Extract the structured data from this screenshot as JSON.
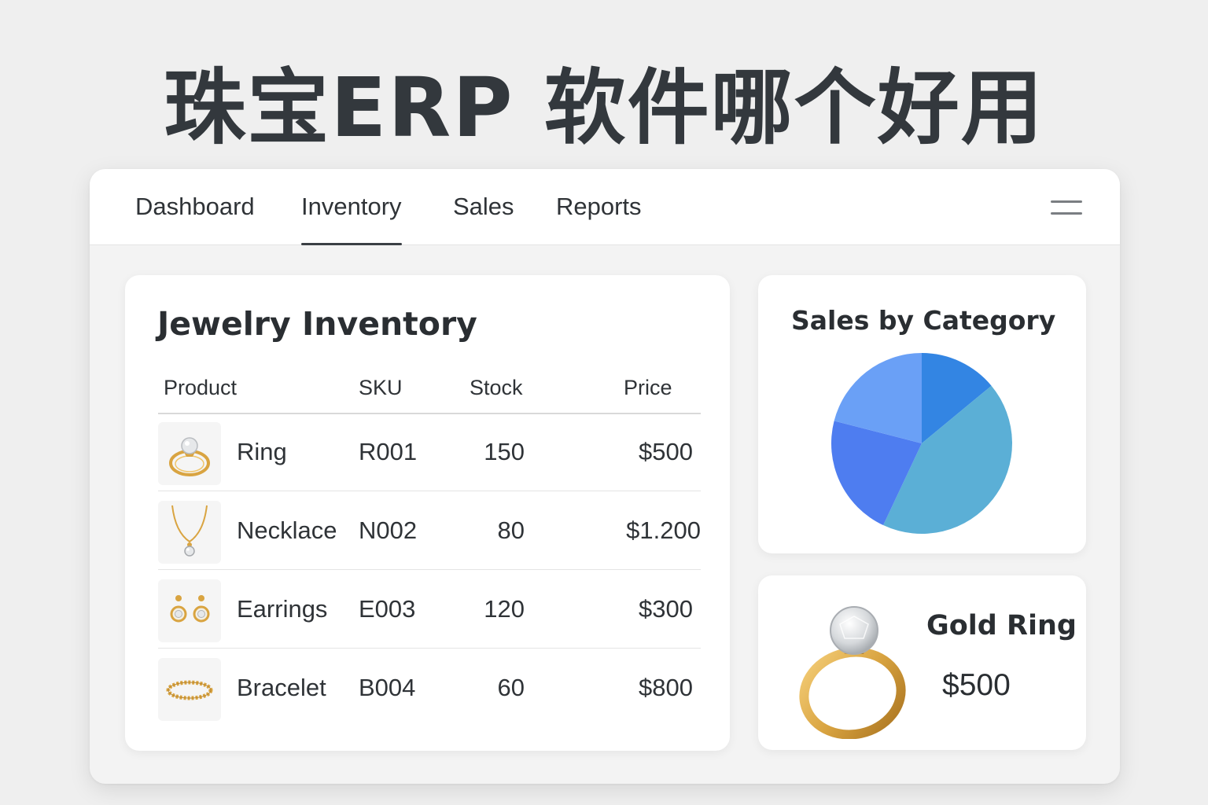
{
  "headline": "珠宝ERP 软件哪个好用",
  "nav": {
    "tabs": [
      {
        "label": "Dashboard"
      },
      {
        "label": "Inventory"
      },
      {
        "label": "Sales"
      },
      {
        "label": "Reports"
      }
    ],
    "active_tab": "Inventory"
  },
  "inventory": {
    "title": "Jewelry Inventory",
    "columns": [
      "Product",
      "SKU",
      "Stock",
      "Price"
    ],
    "rows": [
      {
        "product": "Ring",
        "sku": "R001",
        "stock": "150",
        "price": "$500",
        "icon": "ring-icon"
      },
      {
        "product": "Necklace",
        "sku": "N002",
        "stock": "80",
        "price": "$1.200",
        "icon": "necklace-icon"
      },
      {
        "product": "Earrings",
        "sku": "E003",
        "stock": "120",
        "price": "$300",
        "icon": "earrings-icon"
      },
      {
        "product": "Bracelet",
        "sku": "B004",
        "stock": "60",
        "price": "$800",
        "icon": "bracelet-icon"
      }
    ]
  },
  "sales_chart": {
    "title": "Sales by Category"
  },
  "chart_data": {
    "type": "pie",
    "title": "Sales by Category",
    "values": [
      14,
      43,
      22,
      21
    ],
    "colors": [
      "#3385e3",
      "#5bafd6",
      "#4e7df0",
      "#6aa0f6"
    ]
  },
  "featured": {
    "name": "Gold Ring",
    "price": "$500",
    "icon": "gold-ring-icon"
  },
  "colors": {
    "background": "#efefef",
    "card": "#ffffff",
    "text": "#2b2f33",
    "gold": "#d9a441"
  }
}
